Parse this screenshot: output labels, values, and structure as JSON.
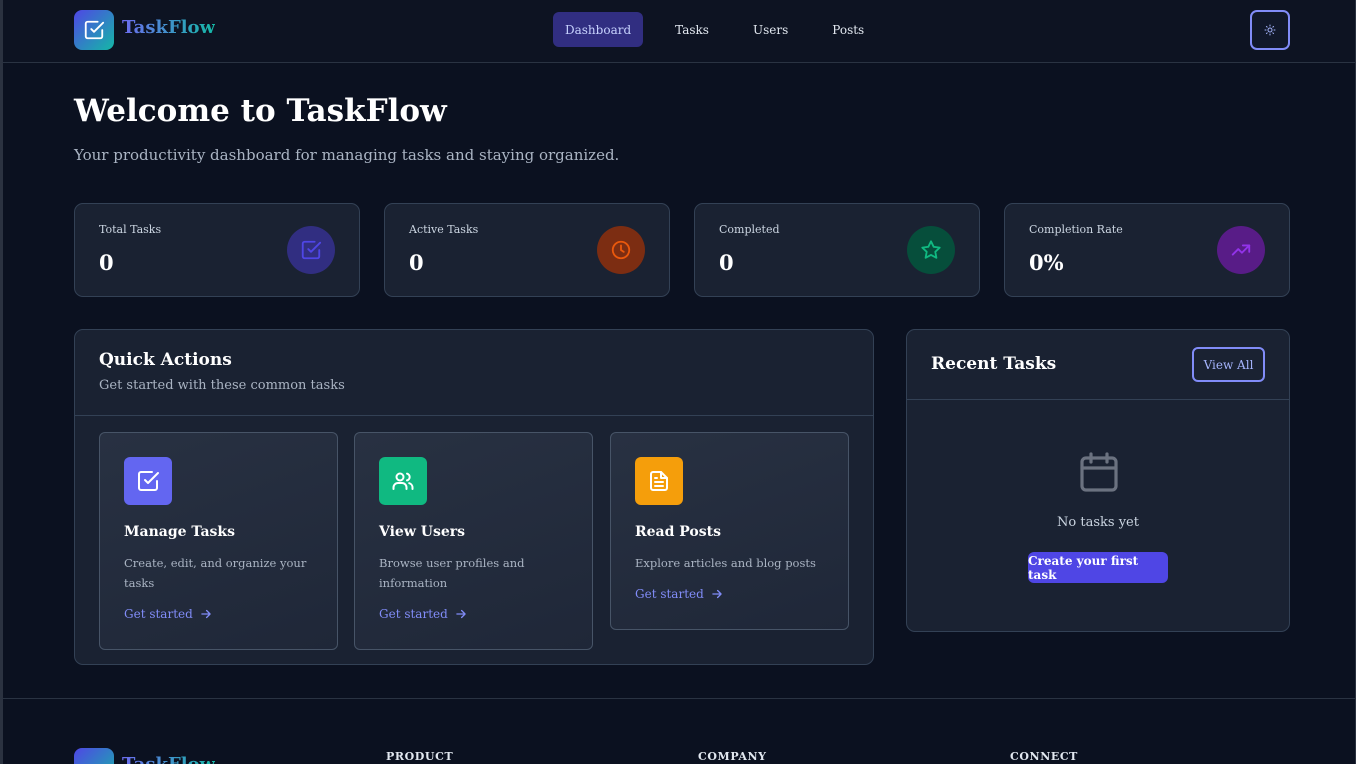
{
  "header": {
    "brand": "TaskFlow",
    "nav": [
      {
        "label": "Dashboard",
        "active": true
      },
      {
        "label": "Tasks",
        "active": false
      },
      {
        "label": "Users",
        "active": false
      },
      {
        "label": "Posts",
        "active": false
      }
    ],
    "theme_toggle_icon": "sun-icon"
  },
  "hero": {
    "title": "Welcome to TaskFlow",
    "subtitle": "Your productivity dashboard for managing tasks and staying organized."
  },
  "stats": [
    {
      "label": "Total Tasks",
      "value": "0",
      "icon": "check-square-icon",
      "color": "#312e81",
      "icon_color": "#4f46e5"
    },
    {
      "label": "Active Tasks",
      "value": "0",
      "icon": "clock-icon",
      "color": "#7c2d12",
      "icon_color": "#ea580c"
    },
    {
      "label": "Completed",
      "value": "0",
      "icon": "star-icon",
      "color": "#064e3b",
      "icon_color": "#10b981"
    },
    {
      "label": "Completion Rate",
      "value": "0%",
      "icon": "trending-up-icon",
      "color": "#581c87",
      "icon_color": "#9333ea"
    }
  ],
  "quick_actions": {
    "title": "Quick Actions",
    "description": "Get started with these common tasks",
    "cards": [
      {
        "title": "Manage Tasks",
        "description": "Create, edit, and organize your tasks",
        "link": "Get started",
        "icon": "check-square-icon",
        "color": "#6366f1"
      },
      {
        "title": "View Users",
        "description": "Browse user profiles and information",
        "link": "Get started",
        "icon": "users-icon",
        "color": "#10b981"
      },
      {
        "title": "Read Posts",
        "description": "Explore articles and blog posts",
        "link": "Get started",
        "icon": "document-icon",
        "color": "#f59e0b"
      }
    ]
  },
  "recent_tasks": {
    "title": "Recent Tasks",
    "view_all": "View All",
    "empty_text": "No tasks yet",
    "create_button": "Create your first task",
    "empty_icon": "calendar-icon"
  },
  "footer": {
    "brand": "TaskFlow",
    "columns": [
      "PRODUCT",
      "COMPANY",
      "CONNECT"
    ]
  }
}
